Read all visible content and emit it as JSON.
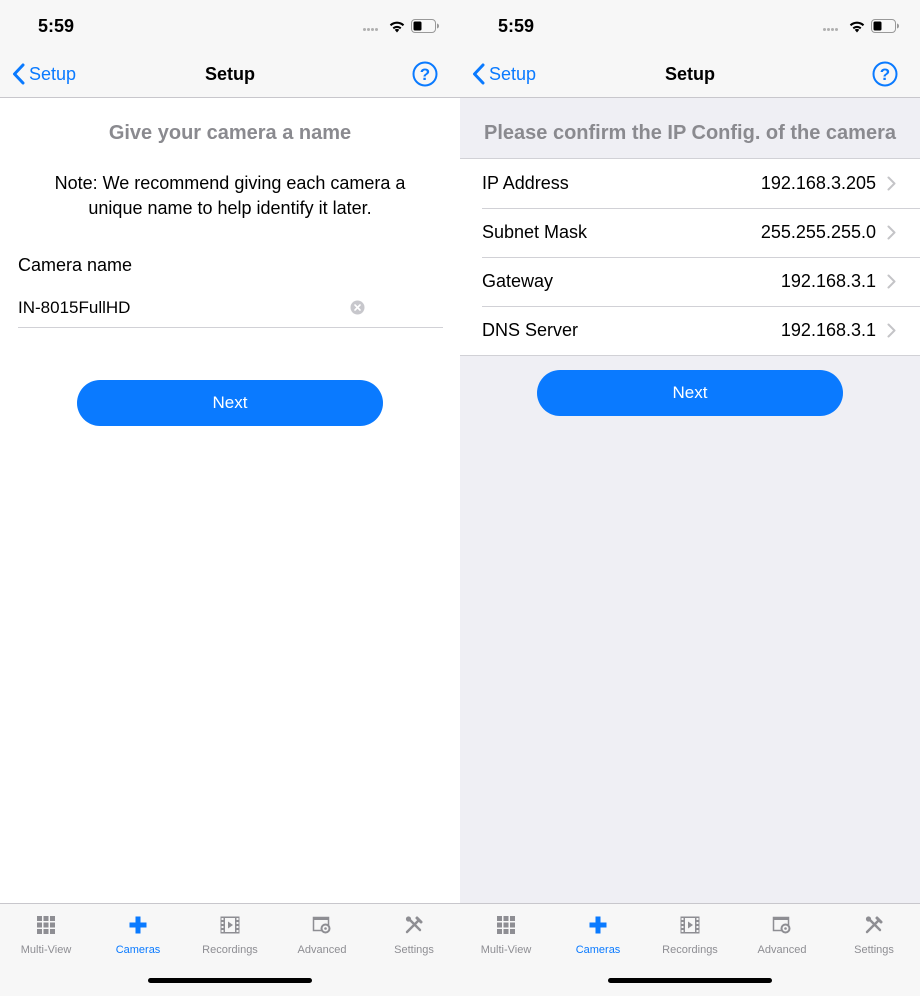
{
  "colors": {
    "accent": "#0a7aff",
    "heading_gray": "#8a8a8f",
    "tab_inactive": "#8e8e93",
    "list_bg": "#efeff4"
  },
  "status_bar": {
    "time": "5:59"
  },
  "nav": {
    "back_label": "Setup",
    "title": "Setup",
    "help_icon": "question-circle-icon"
  },
  "tabs": [
    {
      "label": "Multi-View",
      "icon": "grid-icon",
      "active": false
    },
    {
      "label": "Cameras",
      "icon": "plus-icon",
      "active": true
    },
    {
      "label": "Recordings",
      "icon": "film-icon",
      "active": false
    },
    {
      "label": "Advanced",
      "icon": "window-gear-icon",
      "active": false
    },
    {
      "label": "Settings",
      "icon": "tools-icon",
      "active": false
    }
  ],
  "name_screen": {
    "heading": "Give your camera a name",
    "note": "Note: We recommend giving each camera a unique name to help identify it later.",
    "field_label": "Camera name",
    "camera_name": "IN-8015FullHD",
    "next_label": "Next"
  },
  "ip_screen": {
    "heading": "Please confirm the IP Config. of the camera",
    "rows": [
      {
        "label": "IP Address",
        "value": "192.168.3.205"
      },
      {
        "label": "Subnet Mask",
        "value": "255.255.255.0"
      },
      {
        "label": "Gateway",
        "value": "192.168.3.1"
      },
      {
        "label": "DNS Server",
        "value": "192.168.3.1"
      }
    ],
    "next_label": "Next"
  }
}
